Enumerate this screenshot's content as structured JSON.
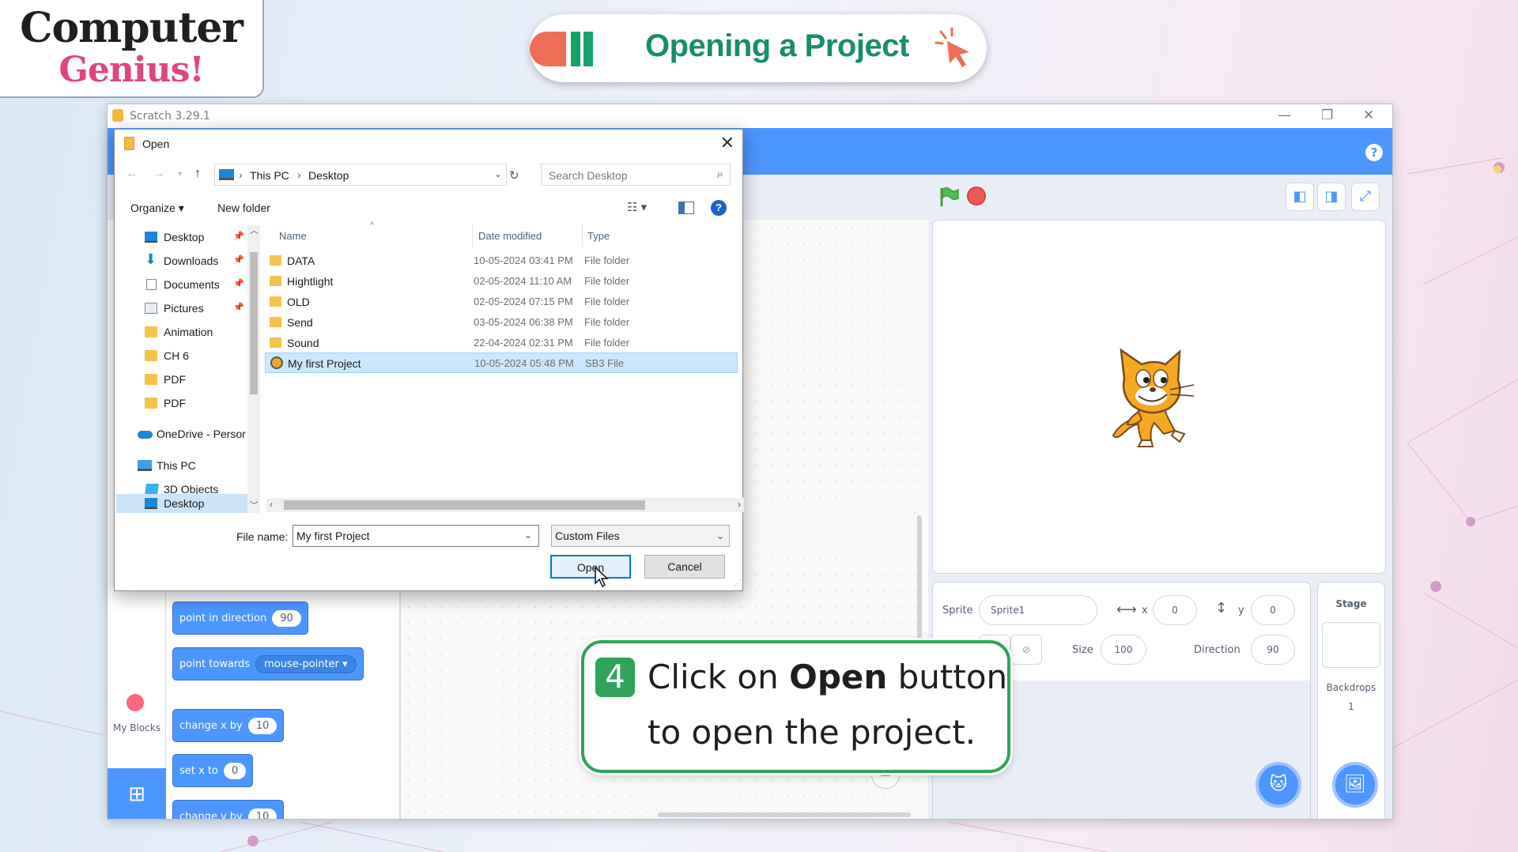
{
  "logo": {
    "line1": "Computer",
    "line2": "Genius!"
  },
  "header": {
    "title": "Opening a Project"
  },
  "scratch": {
    "window_title": "Scratch 3.29.1",
    "win_controls": {
      "minimize": "—",
      "restore": "❐",
      "close": "✕"
    },
    "help": "?",
    "sidebar": {
      "my_blocks": "My Blocks"
    },
    "blocks": [
      {
        "text": "point in direction",
        "value": "90"
      },
      {
        "text": "point towards",
        "dropdown": "mouse-pointer ▾"
      },
      {
        "text": "change x by",
        "value": "10"
      },
      {
        "text": "set x to",
        "value": "0"
      },
      {
        "text": "change y by",
        "value": "10"
      }
    ],
    "sprite_info": {
      "sprite_label": "Sprite",
      "sprite_name": "Sprite1",
      "x_label": "x",
      "x_value": "0",
      "y_label": "y",
      "y_value": "0",
      "size_label": "Size",
      "size_value": "100",
      "direction_label": "Direction",
      "direction_value": "90"
    },
    "stage_pane": {
      "label": "Stage",
      "backdrops_label": "Backdrops",
      "backdrops_count": "1"
    },
    "zoom_reset": "="
  },
  "dialog": {
    "title": "Open",
    "address": {
      "root": "This PC",
      "folder": "Desktop"
    },
    "search_placeholder": "Search Desktop",
    "toolbar": {
      "organize": "Organize ▾",
      "new_folder": "New folder"
    },
    "nav_items": [
      {
        "label": "Desktop",
        "icon": "desktop-icon",
        "pinned": true
      },
      {
        "label": "Downloads",
        "icon": "download-icon",
        "pinned": true
      },
      {
        "label": "Documents",
        "icon": "documents-icon",
        "pinned": true
      },
      {
        "label": "Pictures",
        "icon": "pictures-icon",
        "pinned": true
      },
      {
        "label": "Animation",
        "icon": "folder-icon",
        "pinned": false
      },
      {
        "label": "CH 6",
        "icon": "folder-icon",
        "pinned": false
      },
      {
        "label": "PDF",
        "icon": "folder-icon",
        "pinned": false
      },
      {
        "label": "PDF",
        "icon": "folder-icon",
        "pinned": false
      },
      {
        "label": "OneDrive - Persor",
        "icon": "onedrive-icon",
        "pinned": false
      },
      {
        "label": "This PC",
        "icon": "this-pc-icon",
        "pinned": false
      },
      {
        "label": "3D Objects",
        "icon": "3d-objects-icon",
        "pinned": false
      },
      {
        "label": "Desktop",
        "icon": "desktop-icon",
        "pinned": false
      }
    ],
    "columns": {
      "name": "Name",
      "date": "Date modified",
      "type": "Type"
    },
    "files": [
      {
        "name": "DATA",
        "date": "10-05-2024 03:41 PM",
        "type": "File folder"
      },
      {
        "name": "Hightlight",
        "date": "02-05-2024 11:10 AM",
        "type": "File folder"
      },
      {
        "name": "OLD",
        "date": "02-05-2024 07:15 PM",
        "type": "File folder"
      },
      {
        "name": "Send",
        "date": "03-05-2024 06:38 PM",
        "type": "File folder"
      },
      {
        "name": "Sound",
        "date": "22-04-2024 02:31 PM",
        "type": "File folder"
      },
      {
        "name": "My first Project",
        "date": "10-05-2024 05:48 PM",
        "type": "SB3 File"
      }
    ],
    "file_name_label": "File name:",
    "file_name_value": "My first Project",
    "file_type_value": "Custom Files",
    "open_label": "Open",
    "cancel_label": "Cancel"
  },
  "callout": {
    "step": "4",
    "line1_prefix": "Click on ",
    "line1_bold": "Open",
    "line1_suffix": " button",
    "line2": "to open the project."
  },
  "colors": {
    "scratch_blue": "#4c97ff",
    "title_green": "#178d6c",
    "callout_green": "#2fa35a",
    "logo_pink": "#e0457f"
  }
}
